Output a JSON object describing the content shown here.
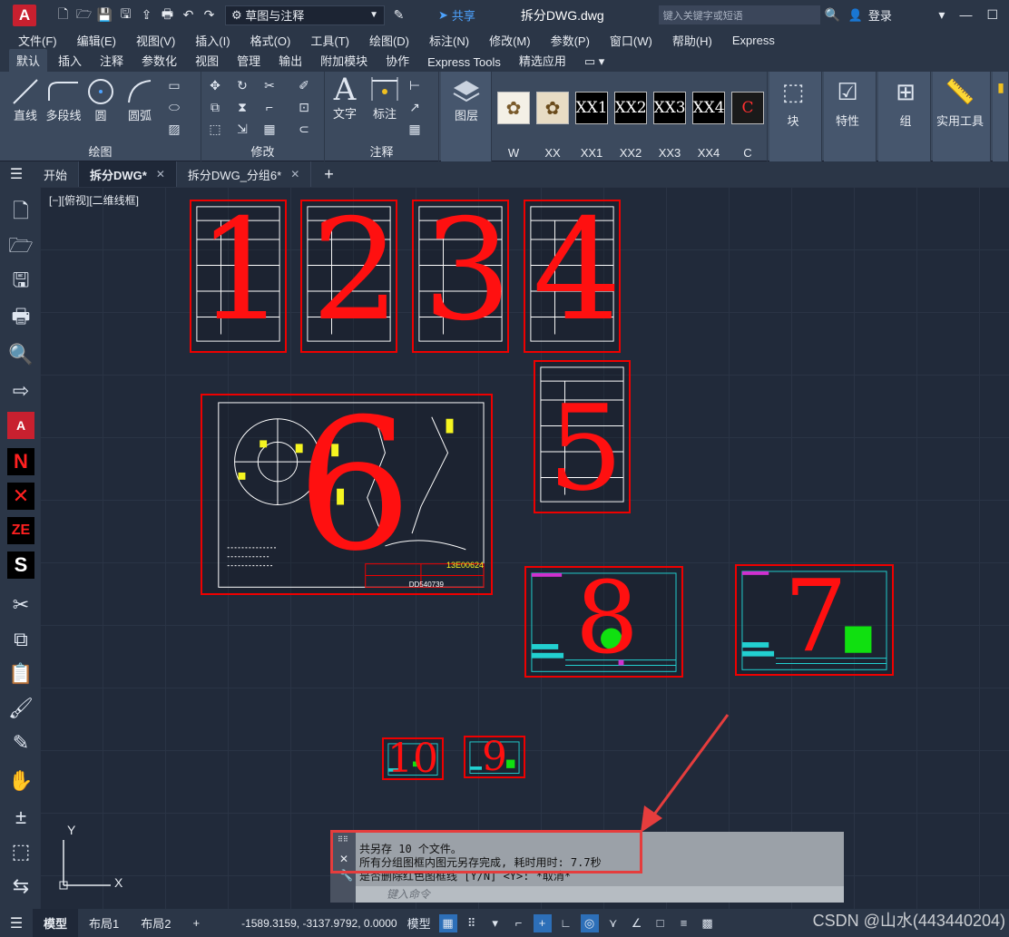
{
  "titlebar": {
    "logo_letter": "A",
    "workspace": "草图与注释",
    "share": "共享",
    "doc_title": "拆分DWG.dwg",
    "search_placeholder": "键入关键字或短语",
    "login": "登录"
  },
  "menu": [
    "文件(F)",
    "编辑(E)",
    "视图(V)",
    "插入(I)",
    "格式(O)",
    "工具(T)",
    "绘图(D)",
    "标注(N)",
    "修改(M)",
    "参数(P)",
    "窗口(W)",
    "帮助(H)",
    "Express"
  ],
  "ribbon_tabs": [
    "默认",
    "插入",
    "注释",
    "参数化",
    "视图",
    "管理",
    "输出",
    "附加模块",
    "协作",
    "Express Tools",
    "精选应用"
  ],
  "ribbon": {
    "draw_panel": "绘图",
    "modify_panel": "修改",
    "annotate_panel": "注释",
    "line": "直线",
    "polyline": "多段线",
    "circle": "圆",
    "arc": "圆弧",
    "text": "文字",
    "dimension": "标注",
    "layers": "图层",
    "thumbs": [
      {
        "label": "W",
        "caption": ""
      },
      {
        "label": "XX",
        "caption": ""
      },
      {
        "label": "XX1",
        "caption": "XX1"
      },
      {
        "label": "XX2",
        "caption": "XX2"
      },
      {
        "label": "XX3",
        "caption": "XX3"
      },
      {
        "label": "XX4",
        "caption": "XX4"
      },
      {
        "label": "C",
        "caption": "C"
      }
    ],
    "block": "块",
    "properties": "特性",
    "group": "组",
    "utilities": "实用工具"
  },
  "file_tabs": {
    "start": "开始",
    "tab1": "拆分DWG*",
    "tab2": "拆分DWG_分组6*"
  },
  "canvas": {
    "view_label": "[−][俯视][二维线框]",
    "frames": [
      "1",
      "2",
      "3",
      "4",
      "5",
      "6",
      "7",
      "8",
      "9",
      "10"
    ],
    "title_block_text": "13E00624",
    "drawing_number": "DD540739"
  },
  "command": {
    "line1": "共另存 10 个文件。",
    "line2": "所有分组图框内图元另存完成, 耗时用时: 7.7秒",
    "line3": "是否删除红色图框线 [Y/N] <Y>: *取消*",
    "input_placeholder": "键入命令"
  },
  "status": {
    "model_tab": "模型",
    "layout1": "布局1",
    "layout2": "布局2",
    "coords": "-1589.3159, -3137.9792, 0.0000",
    "model_mode": "模型"
  },
  "watermark": "CSDN @山水(443440204)"
}
